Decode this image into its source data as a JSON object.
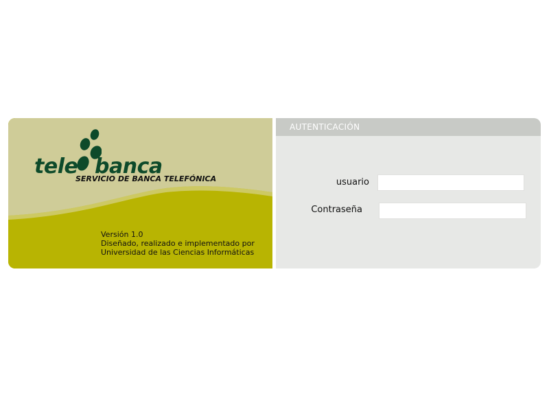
{
  "brand": {
    "logo_left": "tele",
    "logo_right": "banca",
    "tagline": "SERVICIO DE BANCA TELEFÓNICA",
    "version": "Versión 1.0",
    "credits_line1": "Diseñado, realizado e implementado por",
    "credits_line2": "Universidad de las Ciencias Informáticas",
    "colors": {
      "olive": "#b8b402",
      "beige": "#cfcc98",
      "dark_green": "#0d4a2a"
    }
  },
  "auth": {
    "header": "AUTENTICACIÓN",
    "username_label": "usuario",
    "username_value": "",
    "password_label": "Contraseña",
    "password_value": "",
    "colors": {
      "panel_bg": "#e7e8e6",
      "header_bg": "#c8cac6"
    }
  }
}
